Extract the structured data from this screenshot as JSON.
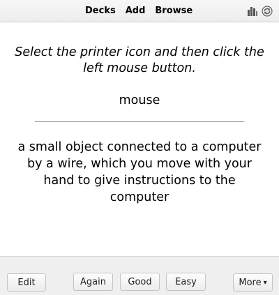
{
  "toolbar": {
    "nav": [
      "Decks",
      "Add",
      "Browse"
    ],
    "icons": [
      "stats-icon",
      "sync-icon"
    ]
  },
  "card": {
    "question_instruction": "Select the printer icon and then click the left mouse button.",
    "question_word": "mouse",
    "answer": "a small object connected to a computer by a wire, which you move with your hand to give instructions to the computer"
  },
  "bottom": {
    "edit_label": "Edit",
    "again_label": "Again",
    "good_label": "Good",
    "easy_label": "Easy",
    "more_label": "More",
    "more_caret": "▾"
  },
  "colors": {
    "toolbar_bg": "#ededed",
    "bottom_bg": "#efefef",
    "divider": "#9c9c9c"
  }
}
